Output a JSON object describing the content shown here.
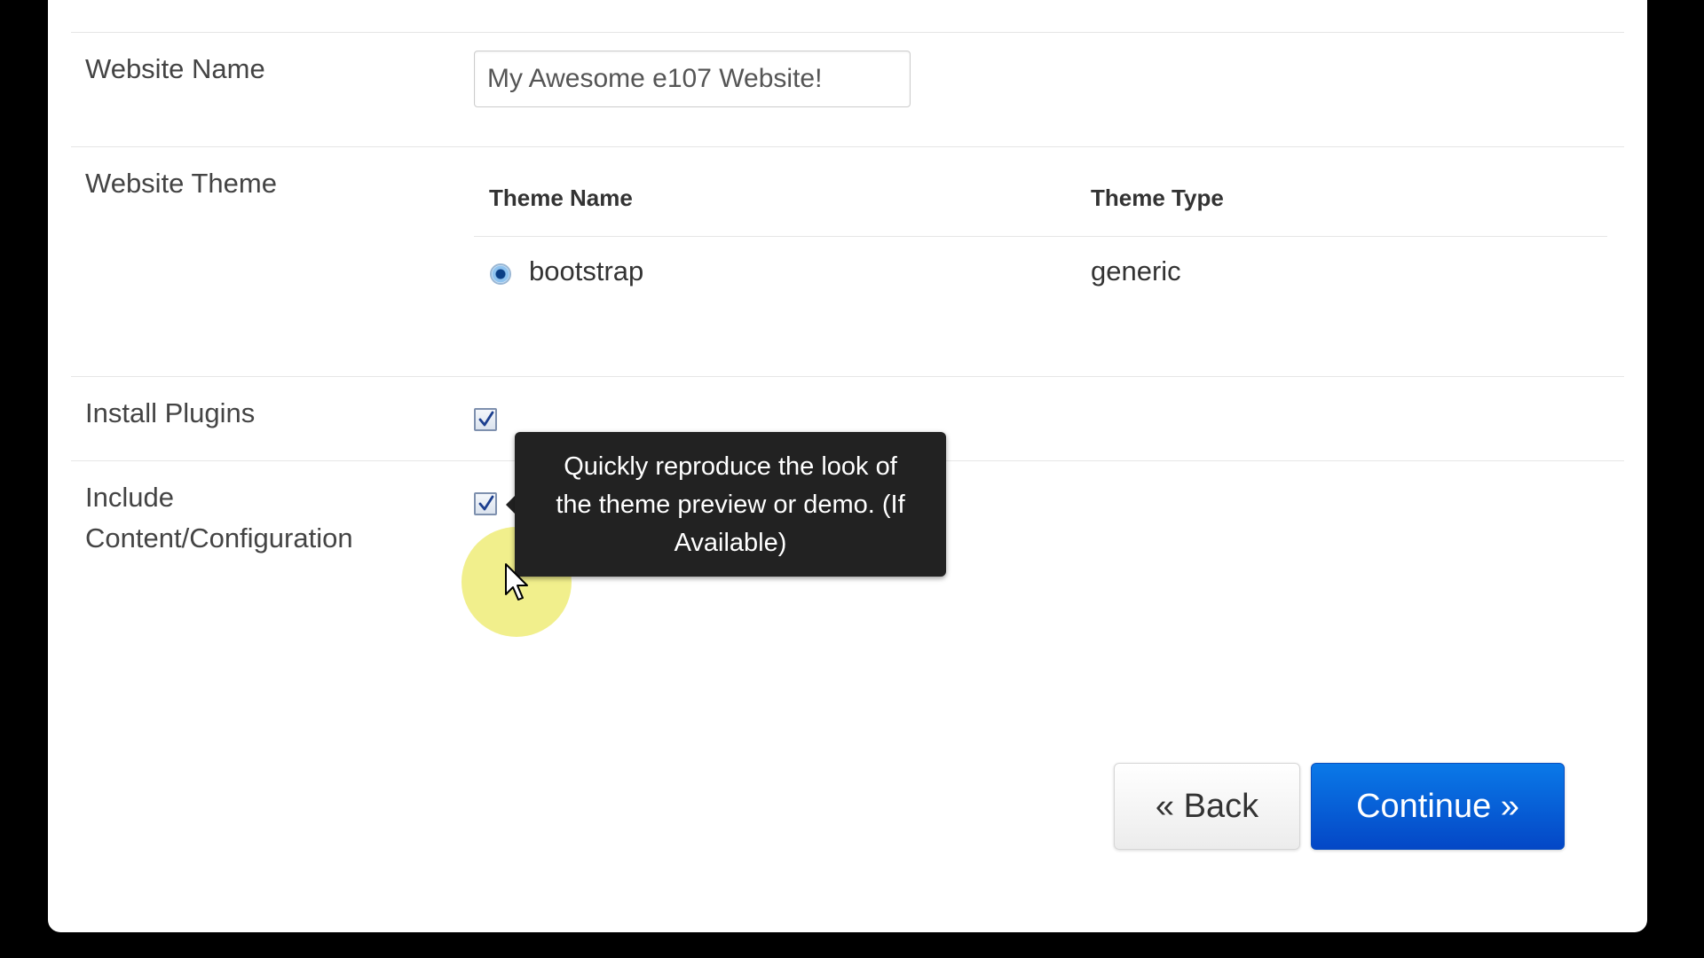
{
  "form": {
    "website_name": {
      "label": "Website Name",
      "value": "My Awesome e107 Website!"
    },
    "website_theme": {
      "label": "Website Theme",
      "columns": [
        "Theme Name",
        "Theme Type"
      ],
      "rows": [
        {
          "name": "bootstrap",
          "type": "generic",
          "selected": true
        }
      ]
    },
    "install_plugins": {
      "label": "Install Plugins",
      "checked": true
    },
    "include_content": {
      "label_line1": "Include",
      "label_line2": "Content/Configuration",
      "checked": true
    },
    "tooltip": {
      "line1": "Quickly reproduce the look of",
      "line2": "the theme preview or demo. (If",
      "line3": "Available)"
    }
  },
  "buttons": {
    "back_label": "« Back",
    "continue_label": "Continue »"
  },
  "colors": {
    "primary": "#0a64d8",
    "tooltip_bg": "#222222",
    "cursor_highlight": "#eeec78"
  },
  "icons": [
    "checkmark-icon",
    "radio-selected-icon",
    "mouse-cursor-icon"
  ]
}
